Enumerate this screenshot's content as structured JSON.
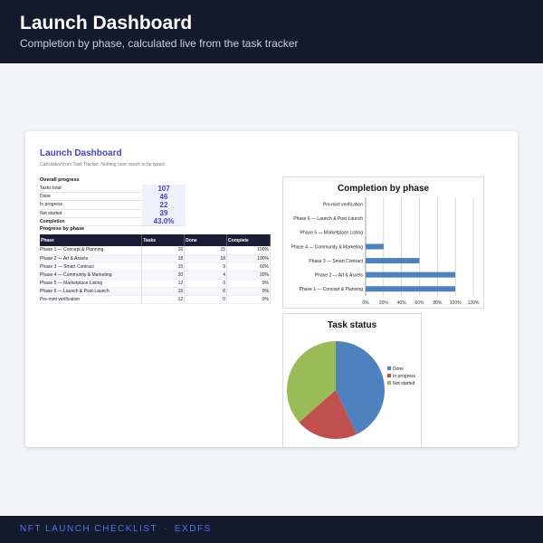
{
  "header": {
    "title": "Launch Dashboard",
    "subtitle": "Completion by phase, calculated live from the task tracker"
  },
  "sheet": {
    "title": "Launch Dashboard",
    "note": "Calculated from Task Tracker. Nothing here needs to be typed.",
    "overall_heading": "Overall progress",
    "overall": [
      {
        "label": "Tasks total",
        "value": "107"
      },
      {
        "label": "Done",
        "value": "46"
      },
      {
        "label": "In progress",
        "value": "22"
      },
      {
        "label": "Not started",
        "value": "39"
      },
      {
        "label": "Completion",
        "value": "43.0%"
      }
    ],
    "phase_heading": "Progress by phase",
    "columns": [
      "Phase",
      "Tasks",
      "Done",
      "Complete"
    ],
    "rows": [
      {
        "phase": "Phase 1 — Concept & Planning",
        "tasks": "15",
        "done": "15",
        "complete": "100%"
      },
      {
        "phase": "Phase 2 — Art & Assets",
        "tasks": "18",
        "done": "18",
        "complete": "100%"
      },
      {
        "phase": "Phase 3 — Smart Contract",
        "tasks": "15",
        "done": "9",
        "complete": "60%"
      },
      {
        "phase": "Phase 4 — Community & Marketing",
        "tasks": "20",
        "done": "4",
        "complete": "20%"
      },
      {
        "phase": "Phase 5 — Marketplace Listing",
        "tasks": "12",
        "done": "0",
        "complete": "0%"
      },
      {
        "phase": "Phase 6 — Launch & Post-Launch",
        "tasks": "15",
        "done": "0",
        "complete": "0%"
      },
      {
        "phase": "Pre-mint verification",
        "tasks": "12",
        "done": "0",
        "complete": "0%"
      }
    ]
  },
  "chart_data": [
    {
      "type": "bar",
      "orientation": "horizontal",
      "title": "Completion by phase",
      "categories": [
        "Phase 1 — Concept & Planning",
        "Phase 2 — Art & Assets",
        "Phase 3 — Smart Contract",
        "Phase 4 — Community & Marketing",
        "Phase 5 — Marketplace Listing",
        "Phase 6 — Launch & Post-Launch",
        "Pre-mint verification"
      ],
      "values": [
        100,
        100,
        60,
        20,
        0,
        0,
        0
      ],
      "x_ticks": [
        "0%",
        "20%",
        "40%",
        "60%",
        "80%",
        "100%",
        "120%"
      ],
      "xlim": [
        0,
        120
      ],
      "grid": true,
      "color": "#4f81bd"
    },
    {
      "type": "pie",
      "title": "Task status",
      "labels": [
        "Done",
        "In progress",
        "Not started"
      ],
      "values": [
        46,
        22,
        39
      ],
      "colors": [
        "#4f81bd",
        "#c0504d",
        "#9bbb59"
      ],
      "legend": "right"
    }
  ],
  "footer": {
    "brand": "NFT LAUNCH CHECKLIST",
    "separator": "·",
    "code": "EXDFS"
  }
}
